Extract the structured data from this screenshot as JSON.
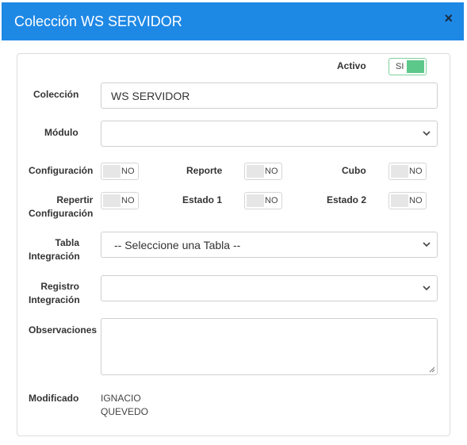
{
  "modal": {
    "title": "Colección WS SERVIDOR",
    "close_label": "×"
  },
  "activo": {
    "label": "Activo",
    "toggle": "SI"
  },
  "coleccion": {
    "label": "Colección",
    "value": "WS SERVIDOR"
  },
  "modulo": {
    "label": "Módulo",
    "value": ""
  },
  "switches": {
    "configuracion": {
      "label": "Configuración",
      "toggle": "NO"
    },
    "reporte": {
      "label": "Reporte",
      "toggle": "NO"
    },
    "cubo": {
      "label": "Cubo",
      "toggle": "NO"
    },
    "repetir": {
      "label_line1": "Repertir",
      "label_line2": "Configuración",
      "toggle": "NO"
    },
    "estado1": {
      "label": "Estado 1",
      "toggle": "NO"
    },
    "estado2": {
      "label": "Estado 2",
      "toggle": "NO"
    }
  },
  "tabla": {
    "label_line1": "Tabla",
    "label_line2": "Integración",
    "value": "-- Seleccione una Tabla --"
  },
  "registro": {
    "label_line1": "Registro",
    "label_line2": "Integración",
    "value": ""
  },
  "observaciones": {
    "label": "Observaciones",
    "value": ""
  },
  "modificado": {
    "label": "Modificado",
    "value_line1": "IGNACIO",
    "value_line2": "QUEVEDO"
  },
  "icons": {
    "close": "close-icon",
    "chevron": "chevron-down-icon"
  }
}
